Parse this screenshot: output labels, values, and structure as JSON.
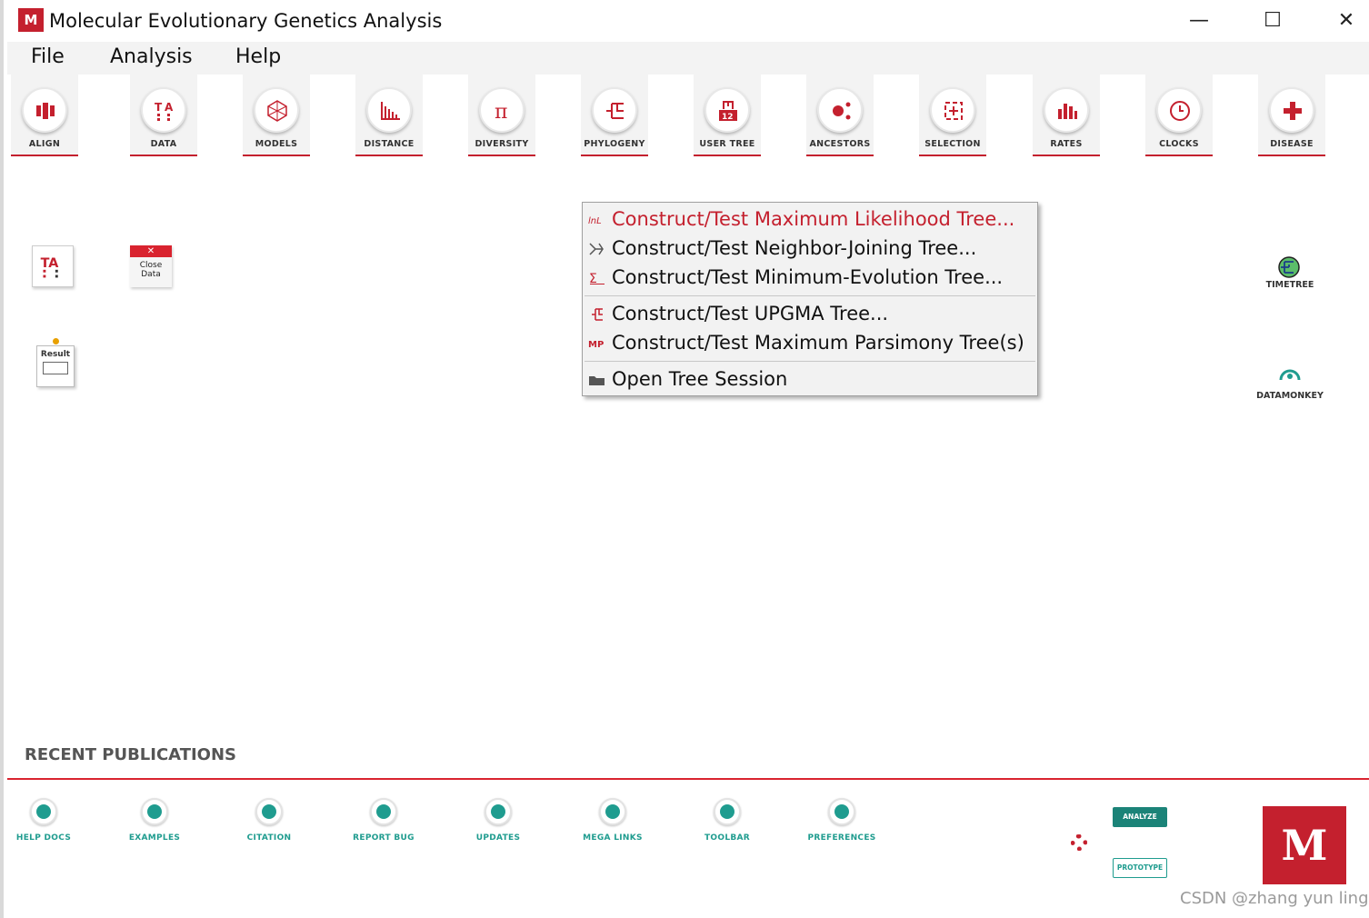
{
  "window": {
    "logo_text": "M",
    "title": "Molecular Evolutionary Genetics Analysis",
    "minimize": "—",
    "maximize": "☐",
    "close": "✕"
  },
  "menubar": {
    "items": [
      "File",
      "Analysis",
      "Help"
    ]
  },
  "toolbar": {
    "items": [
      {
        "label": "ALIGN",
        "icon": "align-icon"
      },
      {
        "label": "DATA",
        "icon": "data-icon"
      },
      {
        "label": "MODELS",
        "icon": "models-icon"
      },
      {
        "label": "DISTANCE",
        "icon": "distance-icon"
      },
      {
        "label": "DIVERSITY",
        "icon": "pi-icon"
      },
      {
        "label": "PHYLOGENY",
        "icon": "phylogeny-icon"
      },
      {
        "label": "USER TREE",
        "icon": "user-tree-icon"
      },
      {
        "label": "ANCESTORS",
        "icon": "ancestors-icon"
      },
      {
        "label": "SELECTION",
        "icon": "selection-icon"
      },
      {
        "label": "RATES",
        "icon": "rates-icon"
      },
      {
        "label": "CLOCKS",
        "icon": "clock-icon"
      },
      {
        "label": "DISEASE",
        "icon": "plus-icon"
      }
    ],
    "accent": "#c4202e"
  },
  "workspace": {
    "close_data": {
      "line1": "Close",
      "line2": "Data",
      "x": "✕"
    },
    "result_label": "Result",
    "ta_label": "TA",
    "timetree_label": "TIMETREE",
    "datamonkey_label": "DATAMONKEY"
  },
  "context_menu": {
    "items": [
      {
        "label": "Construct/Test Maximum Likelihood Tree...",
        "icon": "lnl-icon",
        "highlighted": true
      },
      {
        "label": "Construct/Test Neighbor-Joining Tree...",
        "icon": "nj-icon"
      },
      {
        "label": "Construct/Test Minimum-Evolution Tree...",
        "icon": "me-icon"
      },
      {
        "label": "Construct/Test UPGMA Tree...",
        "icon": "upgma-icon"
      },
      {
        "label": "Construct/Test Maximum Parsimony Tree(s)",
        "icon": "mp-icon"
      },
      {
        "label": "Open Tree Session",
        "icon": "folder-icon"
      }
    ],
    "icon_text": {
      "lnl": "lnL",
      "mp": "MP"
    }
  },
  "publications": {
    "title": "RECENT PUBLICATIONS"
  },
  "bottom_links": [
    "HELP DOCS",
    "EXAMPLES",
    "CITATION",
    "REPORT BUG",
    "UPDATES",
    "MEGA LINKS",
    "TOOLBAR",
    "PREFERENCES"
  ],
  "bottom_buttons": {
    "analyze": "ANALYZE",
    "prototype": "PROTOTYPE"
  },
  "brand_logo": "M",
  "watermark": "CSDN @zhang yun ling",
  "colors": {
    "brand": "#c4202e",
    "teal": "#1f9c8f"
  }
}
